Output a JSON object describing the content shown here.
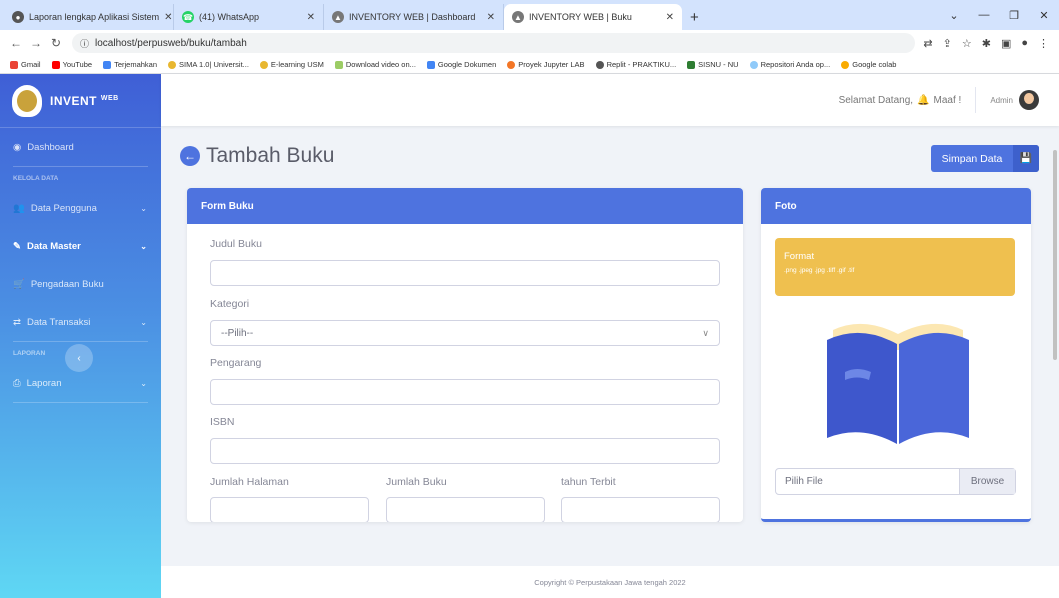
{
  "browser": {
    "tabs": [
      {
        "title": "Laporan lengkap Aplikasi Sistem"
      },
      {
        "title": "(41) WhatsApp"
      },
      {
        "title": "INVENTORY WEB | Dashboard"
      },
      {
        "title": "INVENTORY WEB | Buku"
      }
    ],
    "url": "localhost/perpusweb/buku/tambah",
    "bookmarks": [
      "Gmail",
      "YouTube",
      "Terjemahkan",
      "SIMA 1.0| Universit...",
      "E-learning USM",
      "Download video on...",
      "Google Dokumen",
      "Proyek Jupyter LAB",
      "Replit - PRAKTIKU...",
      "SISNU - NU",
      "Repositori Anda op...",
      "Google colab"
    ]
  },
  "sidebar": {
    "brand": "INVENT",
    "brand_sup": "WEB",
    "dashboard": "Dashboard",
    "section_kelola": "KELOLA DATA",
    "data_pengguna": "Data Pengguna",
    "data_master": "Data Master",
    "pengadaan": "Pengadaan Buku",
    "transaksi": "Data Transaksi",
    "section_laporan": "LAPORAN",
    "laporan": "Laporan"
  },
  "topbar": {
    "greeting": "Selamat Datang,",
    "notice": "Maaf !",
    "user": "Admin"
  },
  "page": {
    "title": "Tambah Buku",
    "save": "Simpan Data"
  },
  "form": {
    "header": "Form Buku",
    "judul": "Judul Buku",
    "kategori": "Kategori",
    "kategori_value": "--Pilih--",
    "pengarang": "Pengarang",
    "isbn": "ISBN",
    "halaman": "Jumlah Halaman",
    "jumlah": "Jumlah Buku",
    "tahun": "tahun Terbit"
  },
  "foto": {
    "header": "Foto",
    "format_title": "Format",
    "format_list": ".png .jpeg .jpg .tiff .gif .tif",
    "file_placeholder": "Pilih File",
    "browse": "Browse"
  },
  "footer": "Copyright © Perpustakaan Jawa tengah 2022",
  "colors": {
    "primary": "#4e73df",
    "warning": "#efc04f"
  }
}
